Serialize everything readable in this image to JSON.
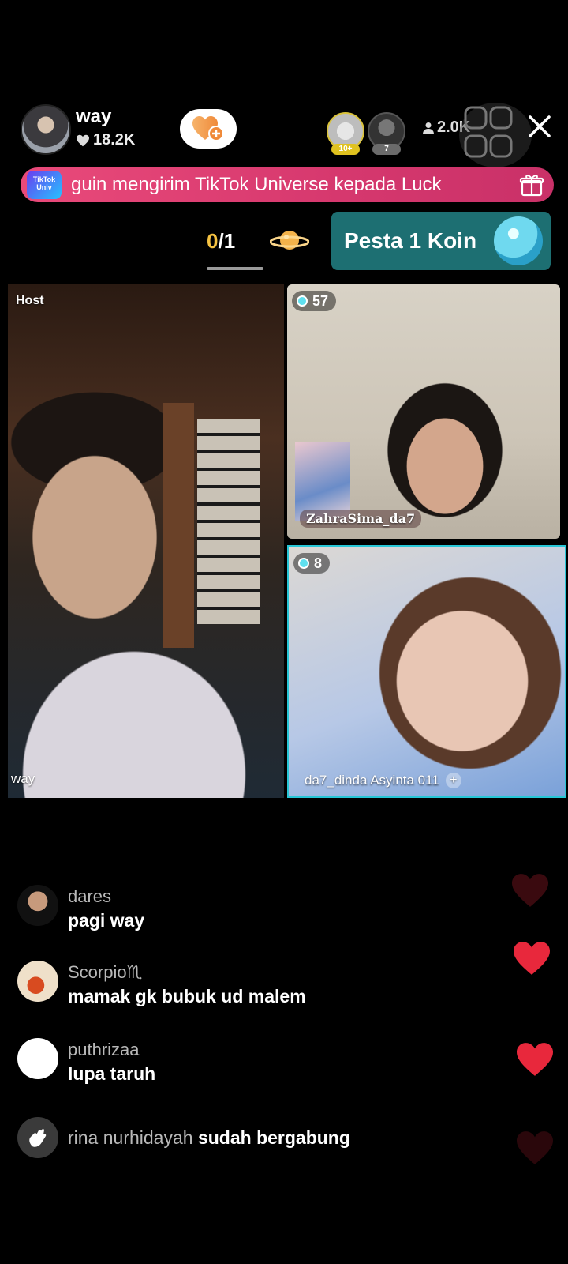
{
  "header": {
    "host_name": "way",
    "likes": "18.2K",
    "viewer_ranks": [
      "10+",
      "7"
    ],
    "viewer_count": "2.0K"
  },
  "gift_banner": {
    "logo_text": "TikTok Univ",
    "text": "guin mengirim TikTok Universe kepada Luck"
  },
  "party": {
    "current": "0",
    "total": "/1",
    "pesta_label": "Pesta 1 Koin"
  },
  "tiles": {
    "host_label": "Host",
    "host_name": "way",
    "guest1_score": "57",
    "guest1_name": "ZahraSima_da7",
    "guest2_score": "8",
    "guest2_name": "da7_dinda Asyinta 011"
  },
  "comments": [
    {
      "user": "dares",
      "text": "pagi way"
    },
    {
      "user": "Scorpio♏",
      "text": "mamak gk bubuk ud malem"
    },
    {
      "user": "puthrizaa",
      "text": "lupa taruh"
    },
    {
      "user": "rina nurhidayah",
      "text": "sudah bergabung"
    }
  ],
  "colors": {
    "banner": "#d6386e",
    "pesta_bg": "#1d6f72",
    "heart": "#e8283c",
    "active_border": "#27c6d6"
  }
}
